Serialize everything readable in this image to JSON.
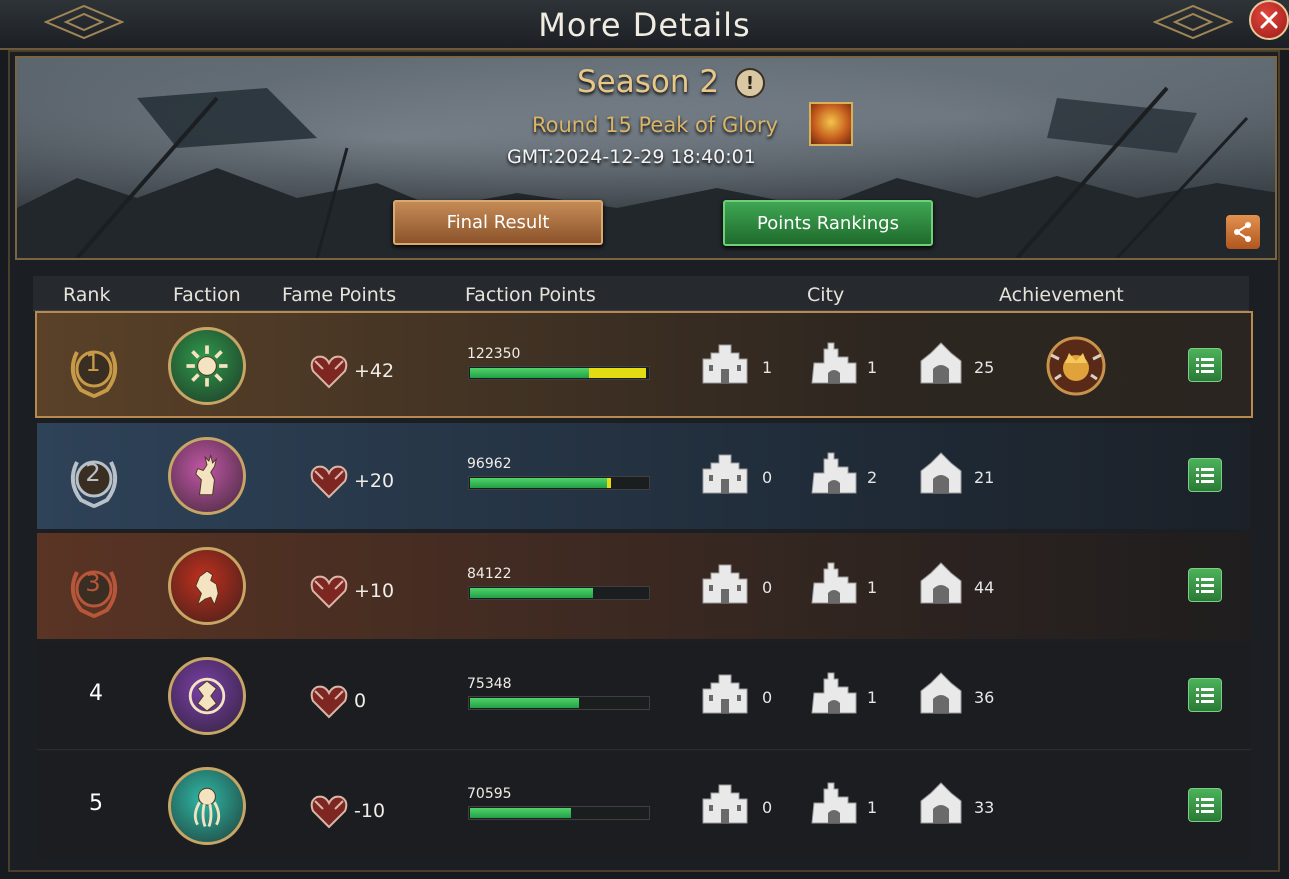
{
  "window": {
    "title": "More Details"
  },
  "banner": {
    "season": "Season 2",
    "round": "Round 15 Peak of Glory",
    "gmt": "GMT:2024-12-29 18:40:01",
    "final_result_label": "Final Result",
    "points_rankings_label": "Points Rankings"
  },
  "table": {
    "headers": {
      "rank": "Rank",
      "faction": "Faction",
      "fame": "Fame Points",
      "faction_points": "Faction Points",
      "city": "City",
      "achievement": "Achievement"
    },
    "rows": [
      {
        "rank": "1",
        "emblem": "sun-emblem-icon",
        "emblem_color": "#2f9a4d",
        "fame": "+42",
        "faction_points": "122350",
        "progress": 0.99,
        "yellow_from": 0.67,
        "city_a": "1",
        "city_b": "1",
        "city_c": "25",
        "achievement": "crown-achievement-icon"
      },
      {
        "rank": "2",
        "emblem": "stag-emblem-icon",
        "emblem_color": "#c257a6",
        "fame": "+20",
        "faction_points": "96962",
        "progress": 0.79,
        "yellow_from": 0.77,
        "city_a": "0",
        "city_b": "2",
        "city_c": "21",
        "achievement": ""
      },
      {
        "rank": "3",
        "emblem": "lion-emblem-icon",
        "emblem_color": "#c0301e",
        "fame": "+10",
        "faction_points": "84122",
        "progress": 0.69,
        "yellow_from": null,
        "city_a": "0",
        "city_b": "1",
        "city_c": "44",
        "achievement": ""
      },
      {
        "rank": "4",
        "emblem": "dragon-emblem-icon",
        "emblem_color": "#7a3fa8",
        "fame": "0",
        "faction_points": "75348",
        "progress": 0.61,
        "yellow_from": null,
        "city_a": "0",
        "city_b": "1",
        "city_c": "36",
        "achievement": ""
      },
      {
        "rank": "5",
        "emblem": "kraken-emblem-icon",
        "emblem_color": "#2fb8a6",
        "fame": "-10",
        "faction_points": "70595",
        "progress": 0.57,
        "yellow_from": null,
        "city_a": "0",
        "city_b": "1",
        "city_c": "33",
        "achievement": ""
      }
    ]
  },
  "colors": {
    "accent_gold": "#e8c889",
    "green_button": "#3fa653",
    "brown_button": "#c58b56",
    "bar_green": "#4fd36a",
    "bar_yellow": "#e4dc12",
    "rank1_gold": "#c79a48",
    "rank2_silver": "#b8c0c8",
    "rank3_bronze": "#b8563a"
  }
}
